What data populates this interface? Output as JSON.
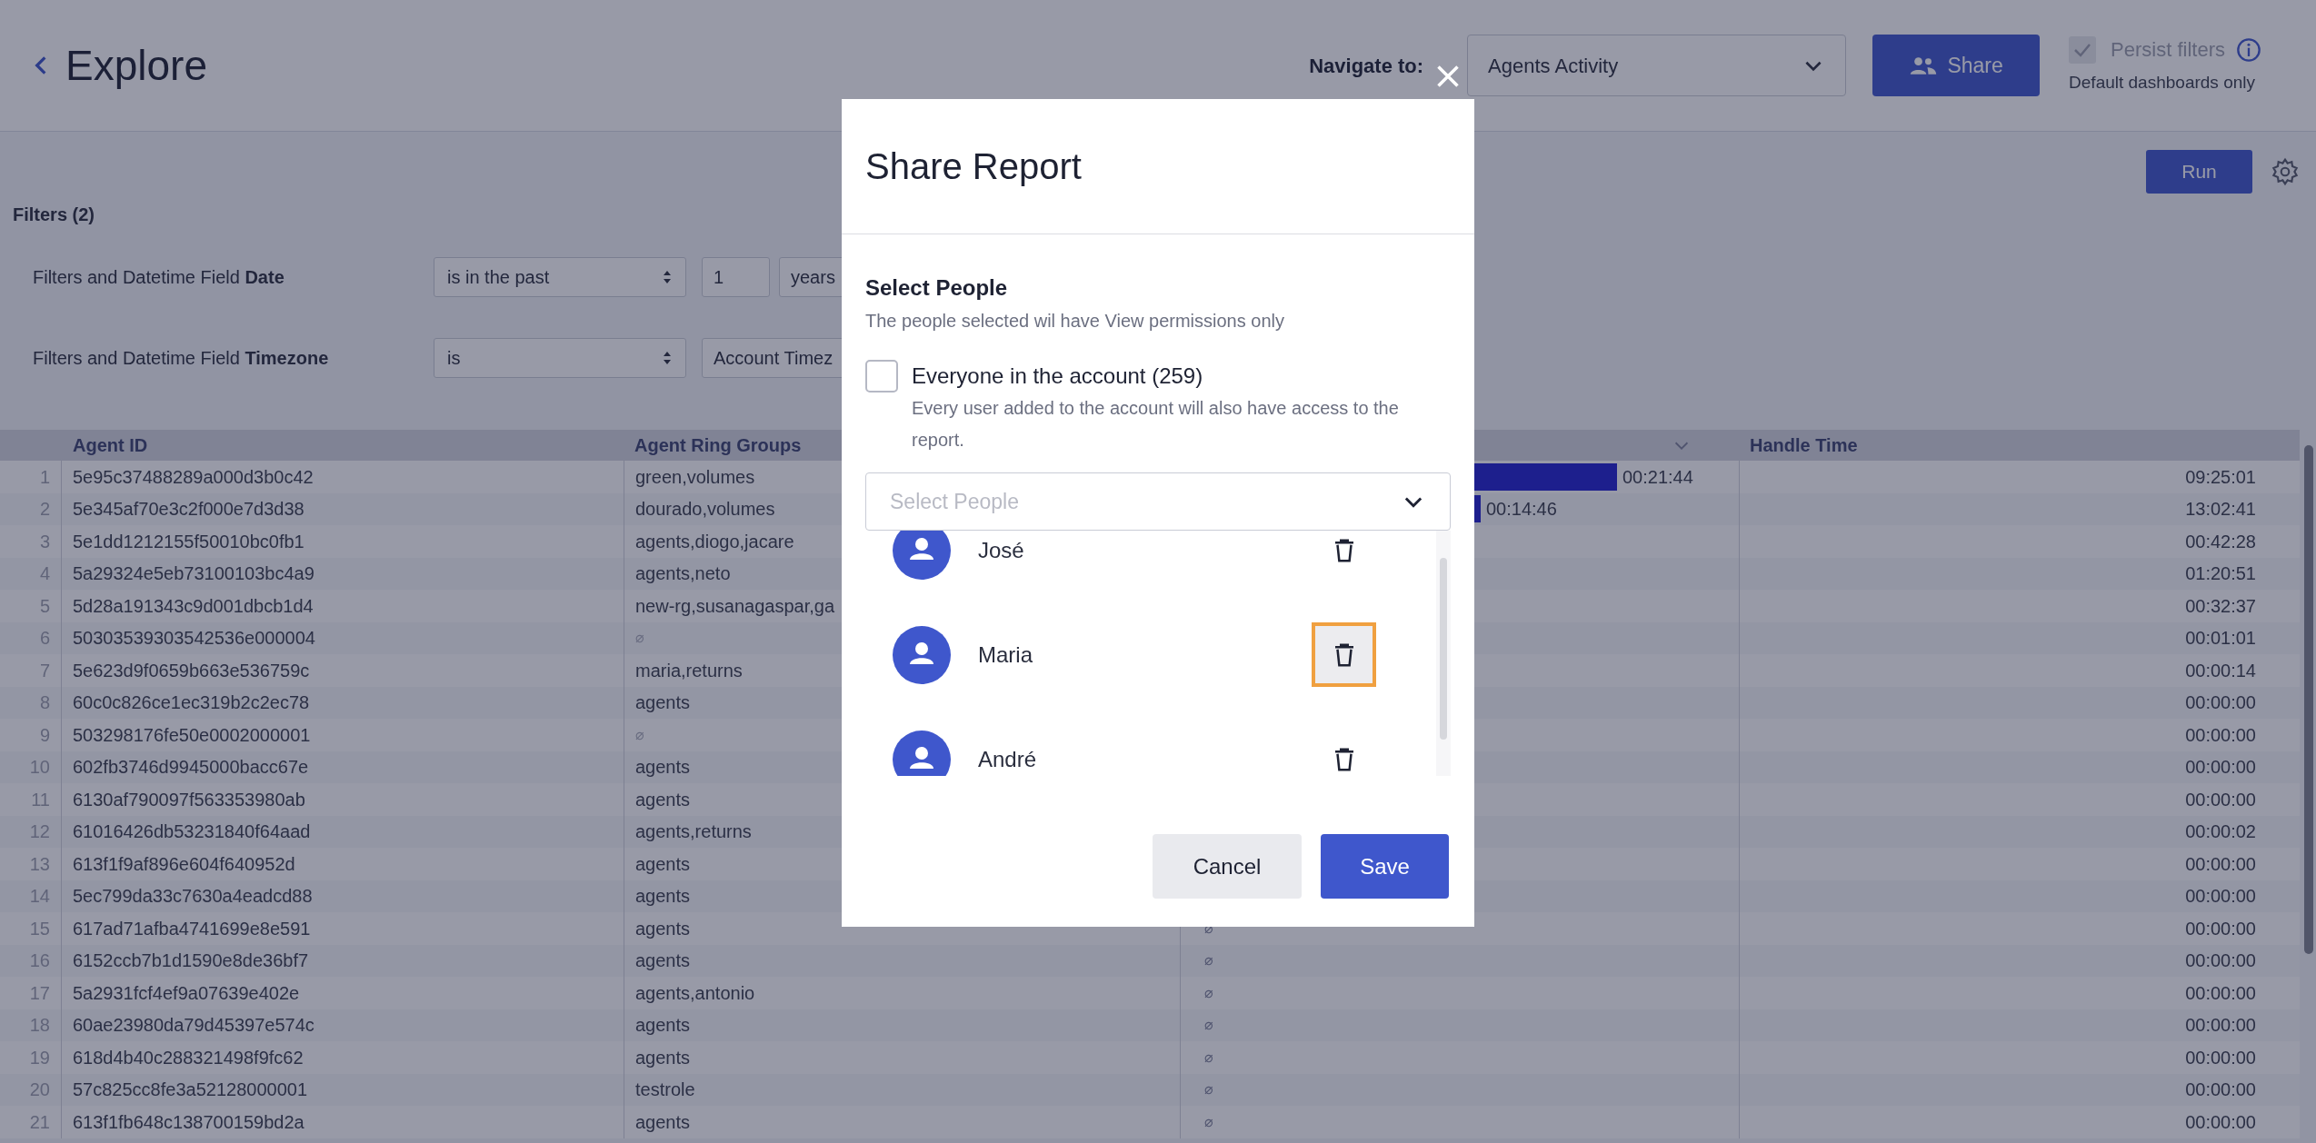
{
  "header": {
    "title": "Explore",
    "navigate_label": "Navigate to:",
    "navigate_value": "Agents Activity",
    "share_button": "Share",
    "persist_filters": {
      "label": "Persist filters",
      "checked": true,
      "disabled": true,
      "note": "Default dashboards only"
    }
  },
  "toolbar": {
    "run_button": "Run"
  },
  "filters": {
    "title": "Filters (2)",
    "rows": [
      {
        "label": "Filters and Datetime Field **Date**",
        "operator": "is in the past",
        "value": "1",
        "unit": "years"
      },
      {
        "label": "Filters and Datetime Field **Timezone**",
        "operator": "is",
        "value": "Account Timez"
      }
    ]
  },
  "table": {
    "columns": [
      {
        "label": "Agent ID",
        "menu": false
      },
      {
        "label": "Agent Ring Groups",
        "menu": false
      },
      {
        "menu": true
      },
      {
        "label": "Handle Time",
        "menu": false
      }
    ],
    "rows": [
      {
        "n": "1",
        "agent_id": "5e95c37488289a000d3b0c42",
        "ring_groups": "green,volumes",
        "column_3": {
          "kind": "bar",
          "level": 0.8,
          "text": "00:21:44"
        },
        "handle_time": "09:25:01"
      },
      {
        "n": "2",
        "agent_id": "5e345af70e3c2f000e7d3d38",
        "ring_groups": "dourado,volumes",
        "column_3": {
          "kind": "bar",
          "level": 0.55,
          "text": "00:14:46"
        },
        "handle_time": "13:02:41"
      },
      {
        "n": "3",
        "agent_id": "5e1dd1212155f50010bc0fb1",
        "ring_groups": "agents,diogo,jacare",
        "handle_time": "00:42:28"
      },
      {
        "n": "4",
        "agent_id": "5a29324e5eb73100103bc4a9",
        "ring_groups": "agents,neto",
        "handle_time": "01:20:51"
      },
      {
        "n": "5",
        "agent_id": "5d28a191343c9d001dbcb1d4",
        "ring_groups": "new-rg,susanagaspar,ga",
        "handle_time": "00:32:37"
      },
      {
        "n": "6",
        "agent_id": "50303539303542536e000004",
        "ring_groups": "⌀",
        "handle_time": "00:01:01"
      },
      {
        "n": "7",
        "agent_id": "5e623d9f0659b663e536759c",
        "ring_groups": "maria,returns",
        "handle_time": "00:00:14"
      },
      {
        "n": "8",
        "agent_id": "60c0c826ce1ec319b2c2ec78",
        "ring_groups": "agents",
        "handle_time": "00:00:00"
      },
      {
        "n": "9",
        "agent_id": "503298176fe50e0002000001",
        "ring_groups": "⌀",
        "handle_time": "00:00:00"
      },
      {
        "n": "10",
        "agent_id": "602fb3746d9945000bacc67e",
        "ring_groups": "agents",
        "handle_time": "00:00:00"
      },
      {
        "n": "11",
        "agent_id": "6130af790097f563353980ab",
        "ring_groups": "agents",
        "handle_time": "00:00:00"
      },
      {
        "n": "12",
        "agent_id": "61016426db53231840f64aad",
        "ring_groups": "agents,returns",
        "handle_time": "00:00:02"
      },
      {
        "n": "13",
        "agent_id": "613f1f9af896e604f640952d",
        "ring_groups": "agents",
        "handle_time": "00:00:00"
      },
      {
        "n": "14",
        "agent_id": "5ec799da33c7630a4eadcd88",
        "ring_groups": "agents",
        "handle_time": "00:00:00"
      },
      {
        "n": "15",
        "agent_id": "617ad71afba4741699e8e591",
        "ring_groups": "agents",
        "column_3": {
          "kind": "null",
          "text": "⌀"
        },
        "handle_time": "00:00:00"
      },
      {
        "n": "16",
        "agent_id": "6152ccb7b1d1590e8de36bf7",
        "ring_groups": "agents",
        "column_3": {
          "kind": "null",
          "text": "⌀"
        },
        "handle_time": "00:00:00"
      },
      {
        "n": "17",
        "agent_id": "5a2931fcf4ef9a07639e402e",
        "ring_groups": "agents,antonio",
        "column_3": {
          "kind": "null",
          "text": "⌀"
        },
        "handle_time": "00:00:00"
      },
      {
        "n": "18",
        "agent_id": "60ae23980da79d45397e574c",
        "ring_groups": "agents",
        "column_3": {
          "kind": "null",
          "text": "⌀"
        },
        "handle_time": "00:00:00"
      },
      {
        "n": "19",
        "agent_id": "618d4b40c288321498f9fc62",
        "ring_groups": "agents",
        "column_3": {
          "kind": "null",
          "text": "⌀"
        },
        "handle_time": "00:00:00"
      },
      {
        "n": "20",
        "agent_id": "57c825cc8fe3a52128000001",
        "ring_groups": "testrole",
        "column_3": {
          "kind": "null",
          "text": "⌀"
        },
        "handle_time": "00:00:00"
      },
      {
        "n": "21",
        "agent_id": "613f1fb648c138700159bd2a",
        "ring_groups": "agents",
        "column_3": {
          "kind": "null",
          "text": "⌀"
        },
        "handle_time": "00:00:00"
      }
    ]
  },
  "dialog": {
    "title": "Share Report",
    "section_title": "Select People",
    "section_hint": "The people selected wil have View permissions only",
    "everyone": {
      "label": "Everyone in the account (259)",
      "hint": "Every user added to the account will also have access to the report.",
      "checked": false
    },
    "select": {
      "placeholder": "Select People"
    },
    "people": [
      {
        "name": "José",
        "focused": false
      },
      {
        "name": "Maria",
        "focused": true
      },
      {
        "name": "André",
        "focused": false
      }
    ],
    "cancel_button": "Cancel",
    "save_button": "Save"
  }
}
